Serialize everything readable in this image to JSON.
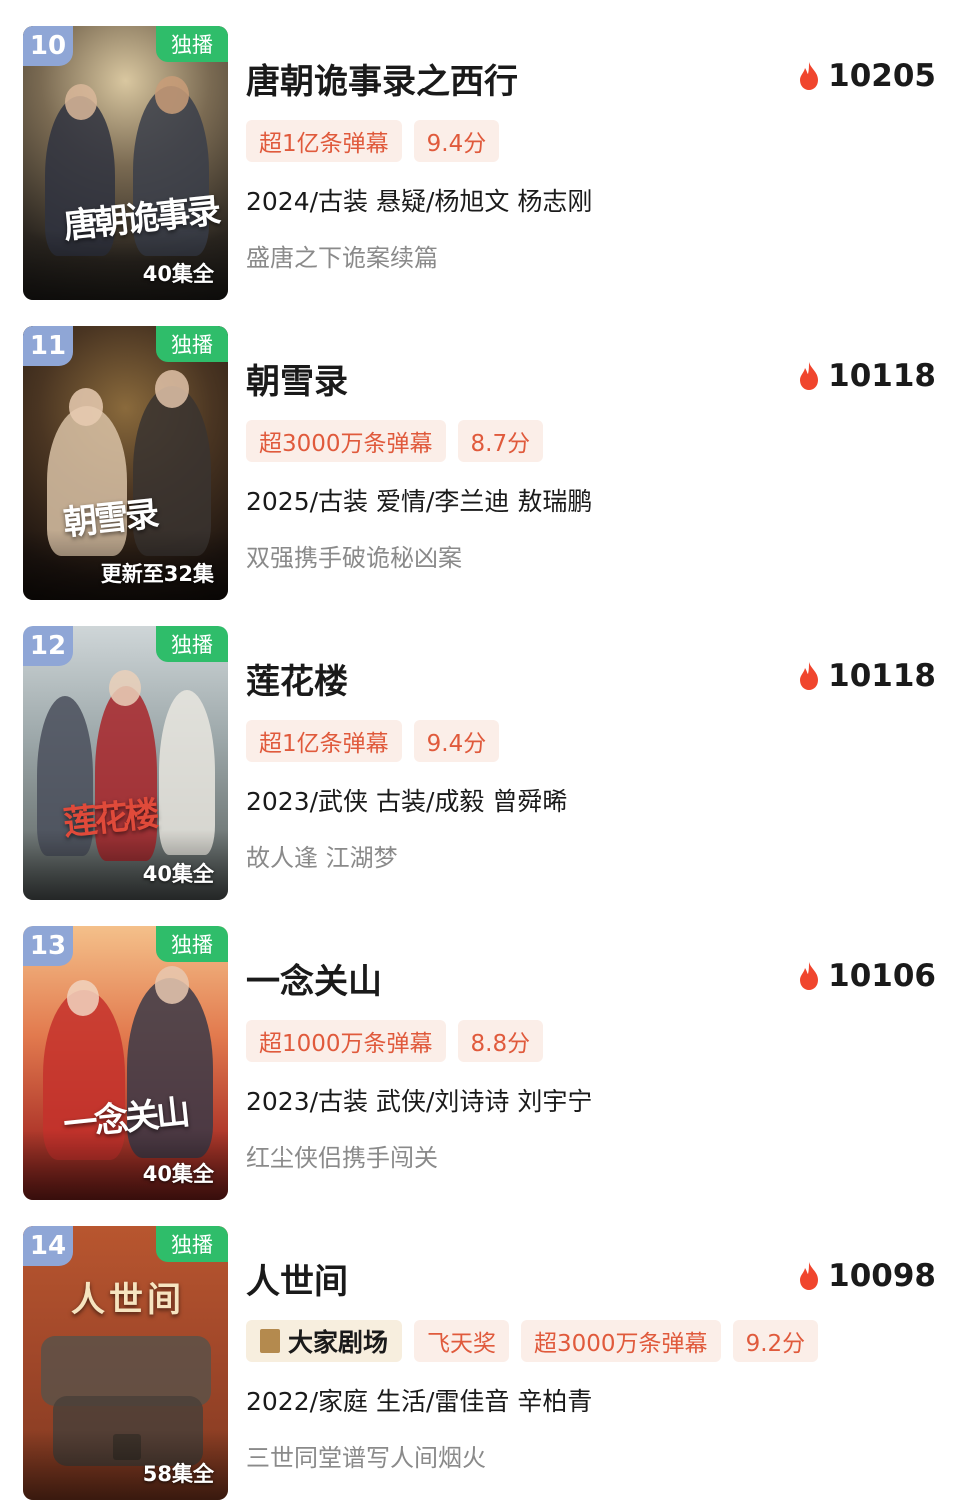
{
  "items": [
    {
      "rank": "10",
      "exclusive": "独播",
      "episodes": "40集全",
      "poster_text": "唐朝诡事录",
      "title": "唐朝诡事录之西行",
      "heat": "10205",
      "tags": [
        "超1亿条弹幕",
        "9.4分"
      ],
      "info": "2024/古装 悬疑/杨旭文 杨志刚",
      "desc": "盛唐之下诡案续篇"
    },
    {
      "rank": "11",
      "exclusive": "独播",
      "episodes": "更新至32集",
      "poster_text": "朝雪录",
      "title": "朝雪录",
      "heat": "10118",
      "tags": [
        "超3000万条弹幕",
        "8.7分"
      ],
      "info": "2025/古装 爱情/李兰迪 敖瑞鹏",
      "desc": "双强携手破诡秘凶案"
    },
    {
      "rank": "12",
      "exclusive": "独播",
      "episodes": "40集全",
      "poster_text": "莲花楼",
      "title": "莲花楼",
      "heat": "10118",
      "tags": [
        "超1亿条弹幕",
        "9.4分"
      ],
      "info": "2023/武侠 古装/成毅 曾舜晞",
      "desc": "故人逢 江湖梦"
    },
    {
      "rank": "13",
      "exclusive": "独播",
      "episodes": "40集全",
      "poster_text": "一念关山",
      "title": "一念关山",
      "heat": "10106",
      "tags": [
        "超1000万条弹幕",
        "8.8分"
      ],
      "info": "2023/古装 武侠/刘诗诗 刘宇宁",
      "desc": "红尘侠侣携手闯关"
    },
    {
      "rank": "14",
      "exclusive": "独播",
      "episodes": "58集全",
      "poster_text": "人世间",
      "title": "人世间",
      "heat": "10098",
      "brand_tag": "大家剧场",
      "tags": [
        "飞天奖",
        "超3000万条弹幕",
        "9.2分"
      ],
      "info": "2022/家庭 生活/雷佳音 辛柏青",
      "desc": "三世同堂谱写人间烟火"
    }
  ],
  "colors": {
    "rank_badge": "#8fa6d6",
    "exclusive_badge": "#2fbd6a",
    "tag_bg": "#fbeee8",
    "tag_text": "#e05a3c",
    "flame": "#f0452d"
  }
}
